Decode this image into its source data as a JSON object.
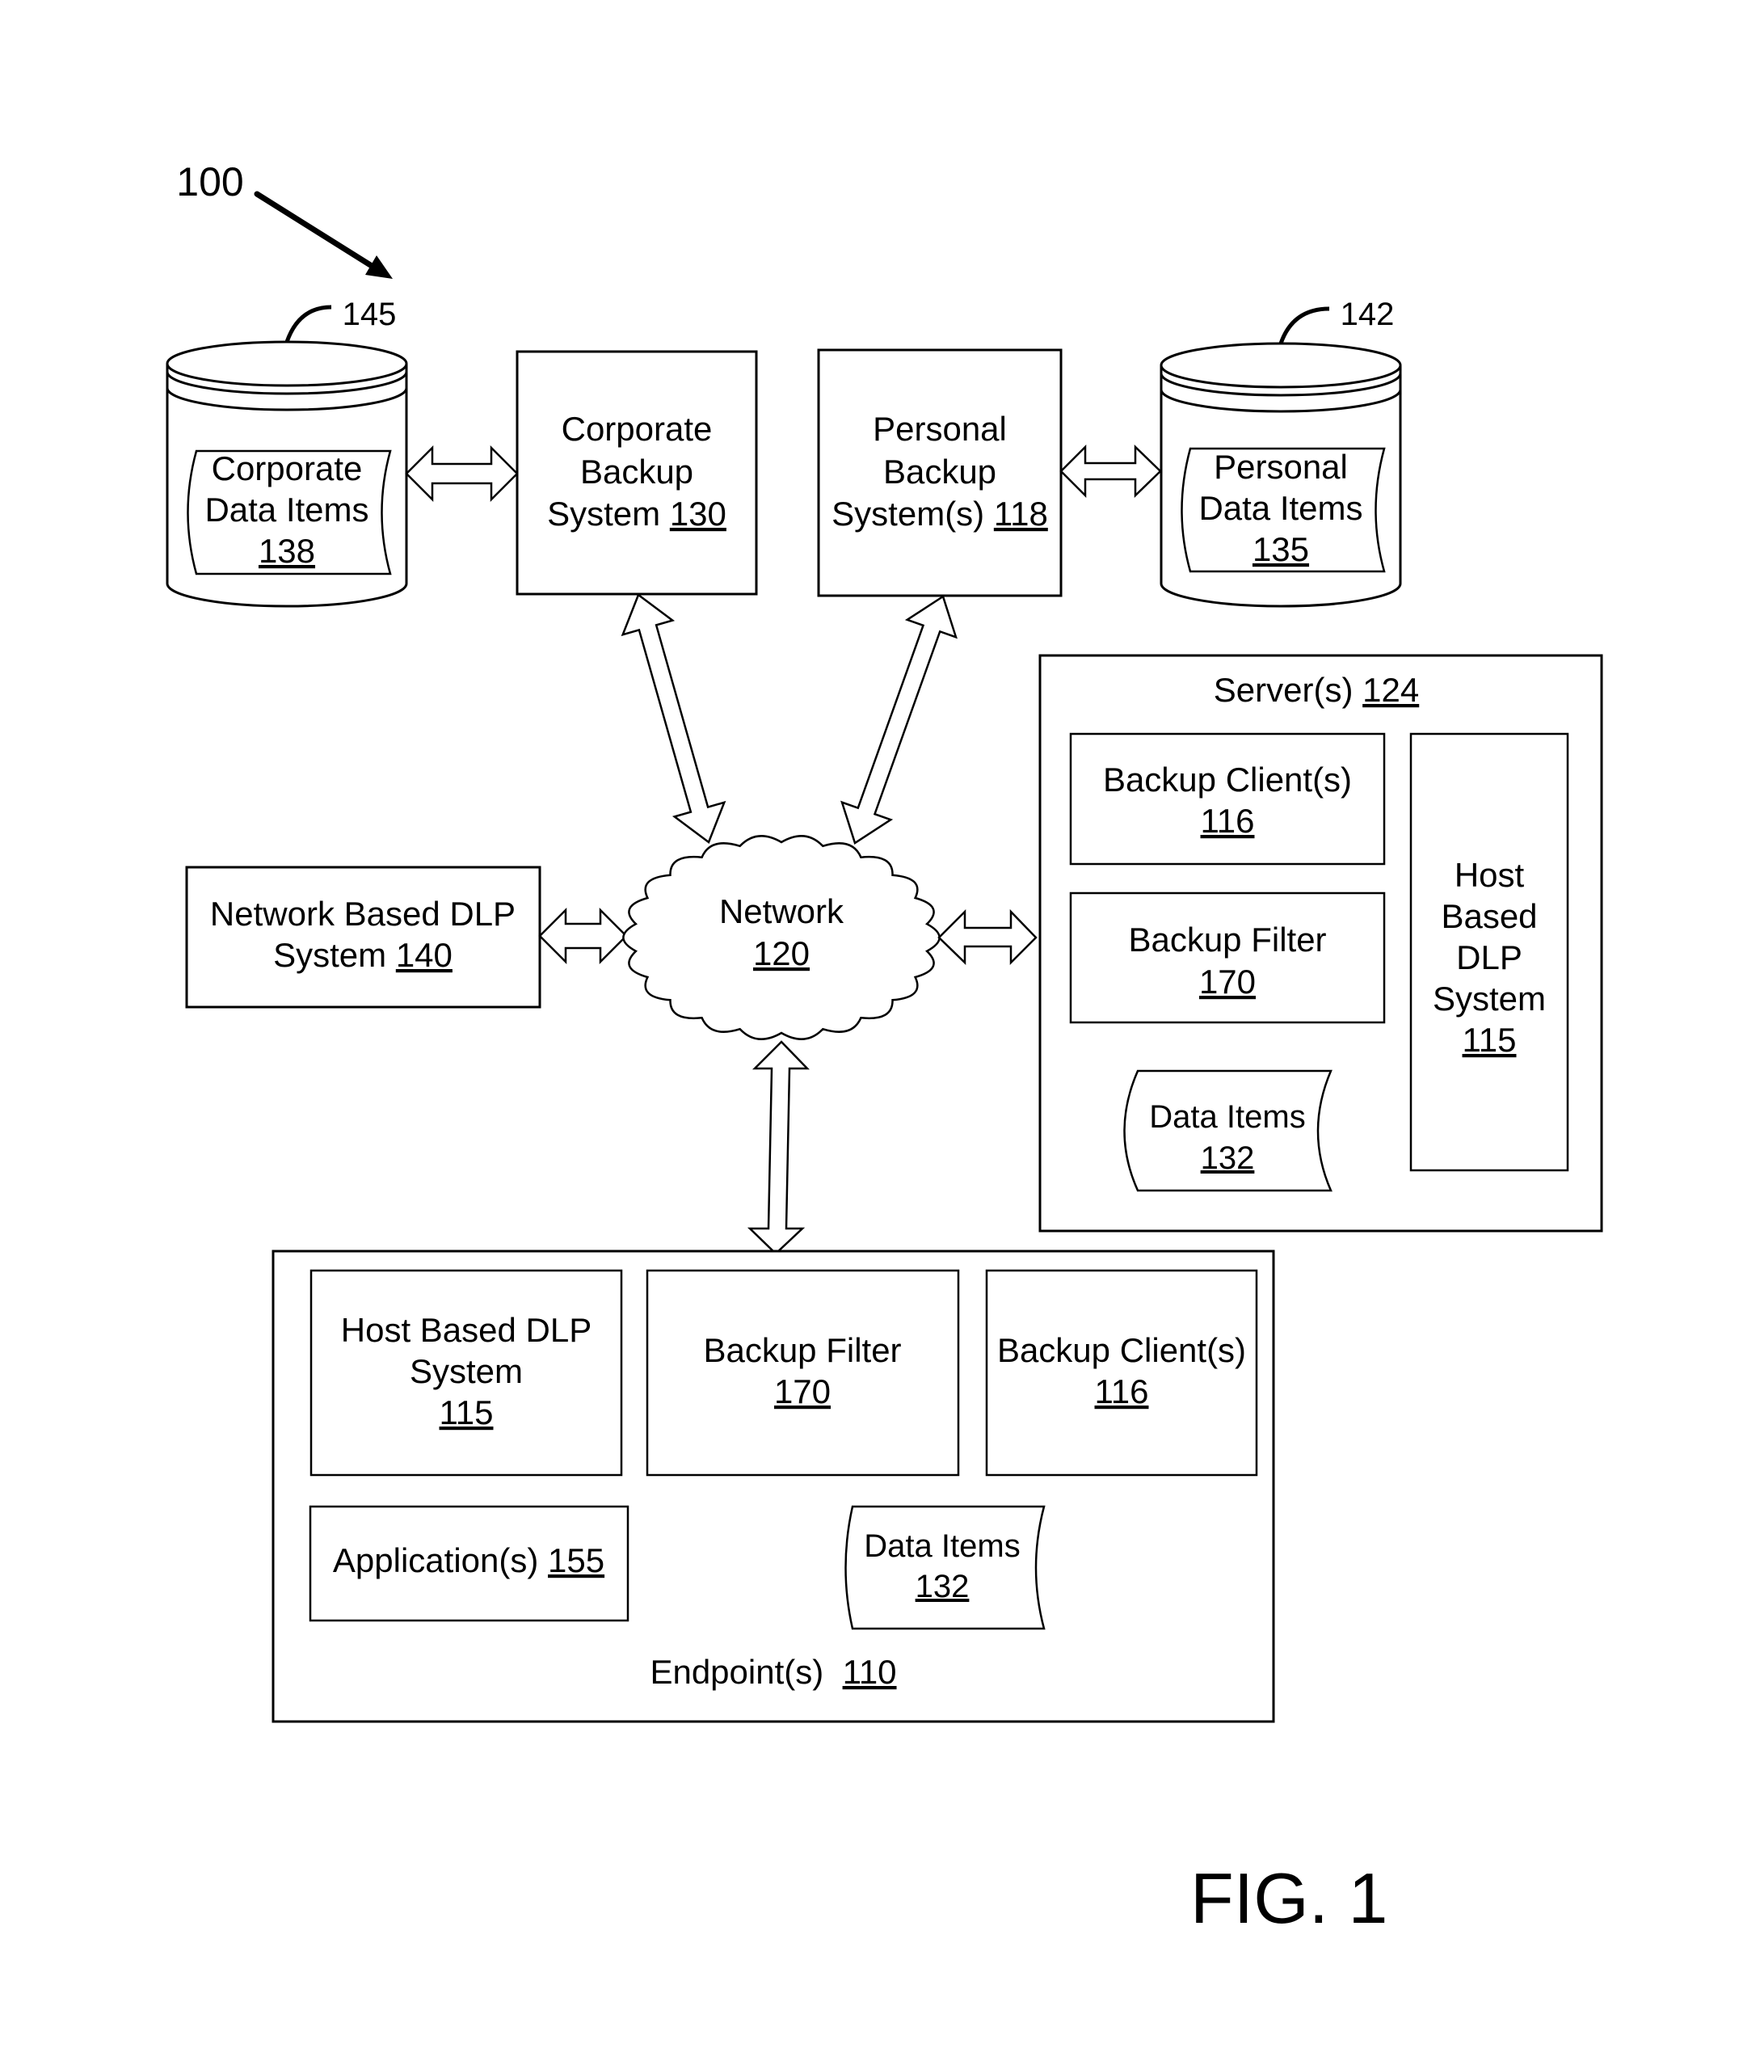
{
  "figure": {
    "label": "FIG. 1",
    "reference": "100"
  },
  "nodes": {
    "corporate_store": {
      "ref": "145",
      "doc_line1": "Corporate",
      "doc_line2": "Data Items",
      "doc_num": "138"
    },
    "personal_store": {
      "ref": "142",
      "doc_line1": "Personal",
      "doc_line2": "Data Items",
      "doc_num": "135"
    },
    "corporate_backup": {
      "line1": "Corporate",
      "line2": "Backup",
      "line3": "System ",
      "num": "130"
    },
    "personal_backup": {
      "line1": "Personal",
      "line2": "Backup",
      "line3": "System(s) ",
      "num": "118"
    },
    "network_dlp": {
      "line1": "Network Based DLP",
      "line2": "System ",
      "num": "140"
    },
    "network": {
      "line1": "Network",
      "num": "120"
    },
    "server": {
      "title": "Server(s) ",
      "num": "124",
      "backup_client": {
        "line1": "Backup Client(s)",
        "num": "116"
      },
      "backup_filter": {
        "line1": "Backup Filter",
        "num": "170"
      },
      "data_items": {
        "line1": "Data Items",
        "num": "132"
      },
      "host_dlp": {
        "line1": "Host",
        "line2": "Based",
        "line3": "DLP",
        "line4": "System",
        "num": "115"
      }
    },
    "endpoint": {
      "title": "Endpoint(s)  ",
      "num": "110",
      "host_dlp": {
        "line1": "Host Based DLP",
        "line2": "System",
        "num": "115"
      },
      "backup_filter": {
        "line1": "Backup Filter",
        "num": "170"
      },
      "backup_client": {
        "line1": "Backup Client(s)",
        "num": "116"
      },
      "applications": {
        "line1": "Application(s) ",
        "num": "155"
      },
      "data_items": {
        "line1": "Data Items",
        "num": "132"
      }
    }
  }
}
